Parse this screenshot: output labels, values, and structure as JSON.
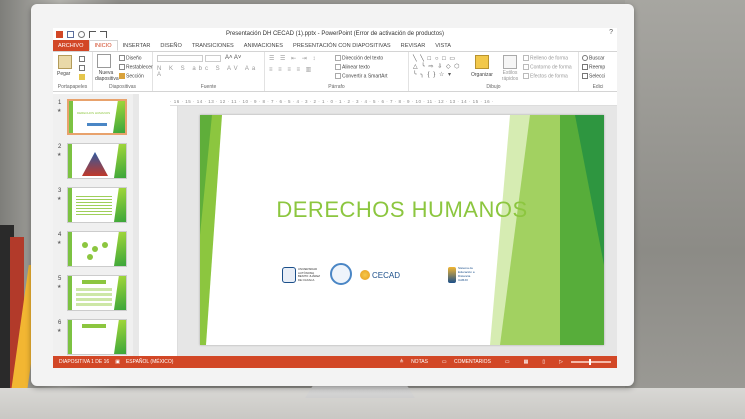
{
  "app": {
    "title": "Presentación DH CECAD (1).pptx - PowerPoint (Error de activación de productos)",
    "help": "?"
  },
  "tabs": [
    {
      "label": "ARCHIVO"
    },
    {
      "label": "INICIO"
    },
    {
      "label": "INSERTAR"
    },
    {
      "label": "DISEÑO"
    },
    {
      "label": "TRANSICIONES"
    },
    {
      "label": "ANIMACIONES"
    },
    {
      "label": "PRESENTACIÓN CON DIAPOSITIVAS"
    },
    {
      "label": "REVISAR"
    },
    {
      "label": "VISTA"
    }
  ],
  "ribbon": {
    "portapapeles": {
      "label": "Portapapeles",
      "paste": "Pegar"
    },
    "diapositivas": {
      "label": "Diapositivas",
      "new_slide": "Nueva diapositiva",
      "layout": "Diseño",
      "reset": "Restablecer",
      "section": "Sección"
    },
    "fuente": {
      "label": "Fuente"
    },
    "parrafo": {
      "label": "Párrafo",
      "text_direction": "Dirección del texto",
      "align_text": "Alinear texto",
      "smartart": "Convertir a SmartArt"
    },
    "dibujo": {
      "label": "Dibujo",
      "arrange": "Organizar",
      "quick_styles": "Estilos rápidos",
      "fill": "Relleno de forma",
      "outline": "Contorno de forma",
      "effects": "Efectos de forma"
    },
    "edicion": {
      "label": "Edici",
      "find": "Buscar",
      "replace": "Reemp",
      "select": "Selecci"
    }
  },
  "ruler": {
    "top_ticks": "· 16 · 15 · 14 · 13 · 12 · 11 · 10 · 9 · 8 · 7 · 6 · 5 · 4 · 3 · 2 · 1 · 0 · 1 · 2 · 3 · 4 · 5 · 6 · 7 · 8 · 9 · 10 · 11 · 12 · 13 · 14 · 15 · 16 ·"
  },
  "thumbnails": [
    {
      "num": "1",
      "star": "★",
      "caption": "DERECHOS HUMANOS"
    },
    {
      "num": "2",
      "star": "★"
    },
    {
      "num": "3",
      "star": "★"
    },
    {
      "num": "4",
      "star": "★"
    },
    {
      "num": "5",
      "star": "★"
    },
    {
      "num": "6",
      "star": "★"
    }
  ],
  "slide": {
    "title": "DERECHOS HUMANOS",
    "logos": {
      "uni": "UNIVERSIDAD AUTÓNOMA BENITO JUÁREZ DE OAXACA",
      "cecad": "CECAD",
      "sistema": "Sistema de Educación a Distancia UABJO"
    }
  },
  "statusbar": {
    "slide_info": "DIAPOSITIVA 1 DE 16",
    "language": "ESPAÑOL (MÉXICO)",
    "notes": "NOTAS",
    "comments": "COMENTARIOS"
  },
  "colors": {
    "accent": "#d24726",
    "slide_green": "#8cc63f"
  }
}
